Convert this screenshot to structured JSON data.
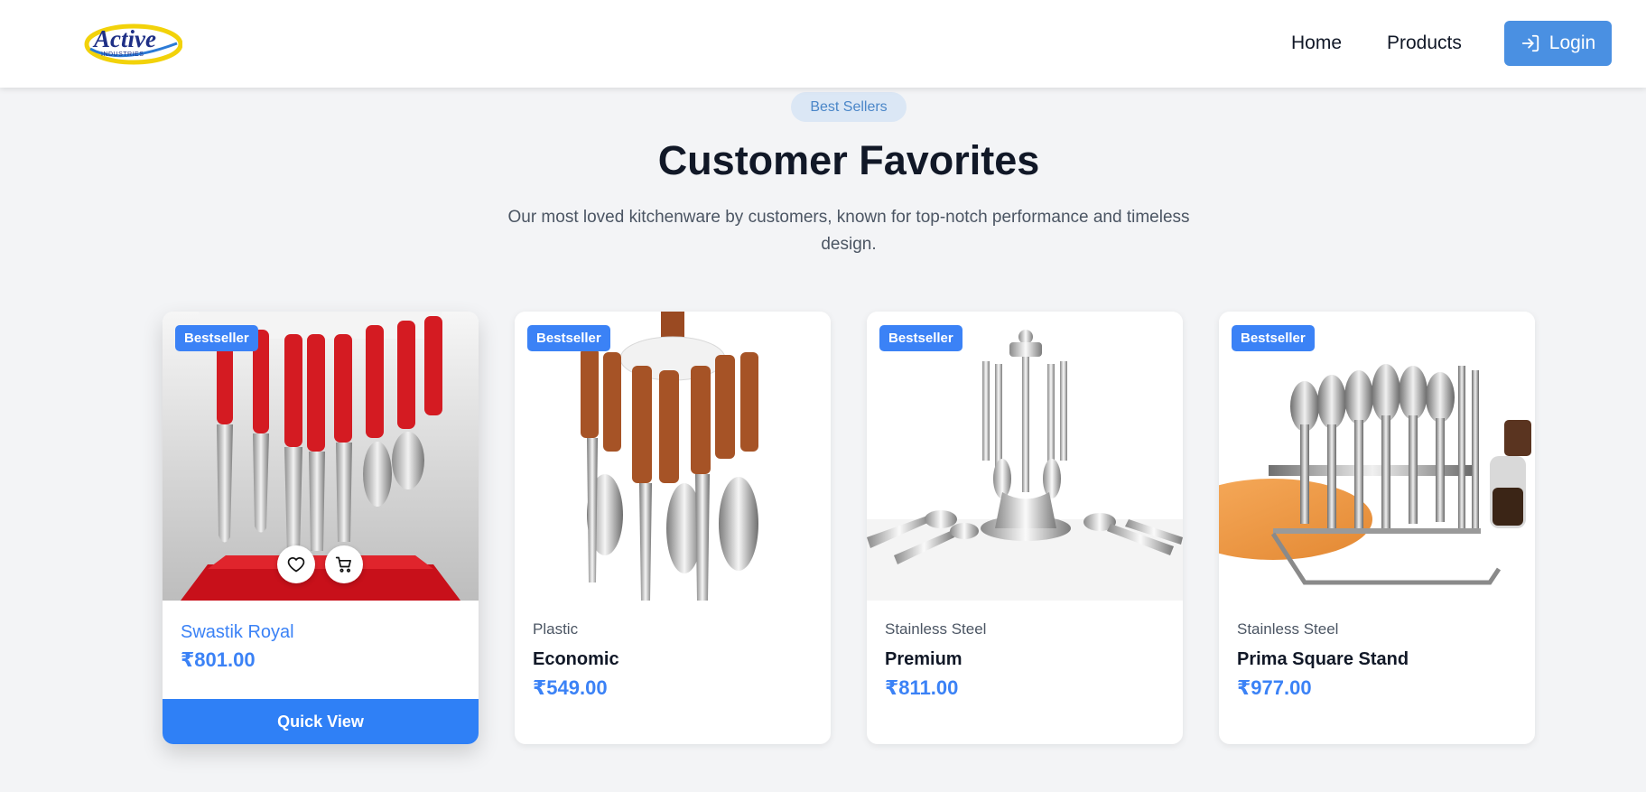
{
  "nav": {
    "logo": {
      "main": "Active",
      "sub": "INDUSTRIES"
    },
    "links": [
      "Home",
      "Products"
    ],
    "login_label": "Login"
  },
  "section": {
    "pill": "Best Sellers",
    "title": "Customer Favorites",
    "subtitle": "Our most loved kitchenware by customers, known for top-notch performance and timeless design."
  },
  "products": [
    {
      "badge": "Bestseller",
      "category": "",
      "name": "Swastik Royal",
      "price": "₹801.00",
      "quick_view": "Quick View"
    },
    {
      "badge": "Bestseller",
      "category": "Plastic",
      "name": "Economic",
      "price": "₹549.00"
    },
    {
      "badge": "Bestseller",
      "category": "Stainless Steel",
      "name": "Premium",
      "price": "₹811.00"
    },
    {
      "badge": "Bestseller",
      "category": "Stainless Steel",
      "name": "Prima Square Stand",
      "price": "₹977.00"
    }
  ],
  "icons": {
    "login": "login-arrow-icon",
    "wishlist": "heart-icon",
    "cart": "cart-icon"
  },
  "colors": {
    "accent": "#3b82f6",
    "login_button": "#4a90e2",
    "pill_bg": "#dbe7f5",
    "page_bg": "#f3f4f6"
  }
}
